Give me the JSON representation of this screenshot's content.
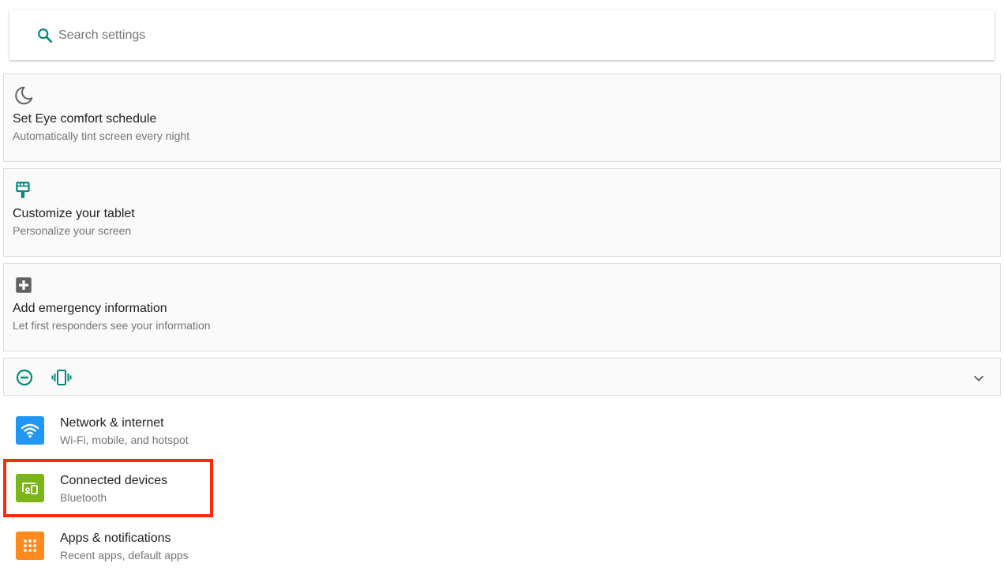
{
  "search": {
    "placeholder": "Search settings",
    "value": ""
  },
  "suggestions": [
    {
      "title": "Set Eye comfort schedule",
      "subtitle": "Automatically tint screen every night",
      "icon": "moon-icon"
    },
    {
      "title": "Customize your tablet",
      "subtitle": "Personalize your screen",
      "icon": "paintbrush-icon"
    },
    {
      "title": "Add emergency information",
      "subtitle": "Let first responders see your information",
      "icon": "medical-plus-icon"
    }
  ],
  "conditions": {
    "icons": [
      "do-not-disturb-icon",
      "vibrate-icon"
    ],
    "expand_icon": "chevron-down-icon"
  },
  "settings": [
    {
      "title": "Network & internet",
      "subtitle": "Wi-Fi, mobile, and hotspot",
      "icon": "wifi-icon",
      "color": "#2196f3"
    },
    {
      "title": "Connected devices",
      "subtitle": "Bluetooth",
      "icon": "devices-icon",
      "color": "#7cb518"
    },
    {
      "title": "Apps & notifications",
      "subtitle": "Recent apps, default apps",
      "icon": "apps-grid-icon",
      "color": "#ff8a1f"
    }
  ],
  "colors": {
    "accent": "#00897b",
    "highlight": "#ff2a0a"
  }
}
